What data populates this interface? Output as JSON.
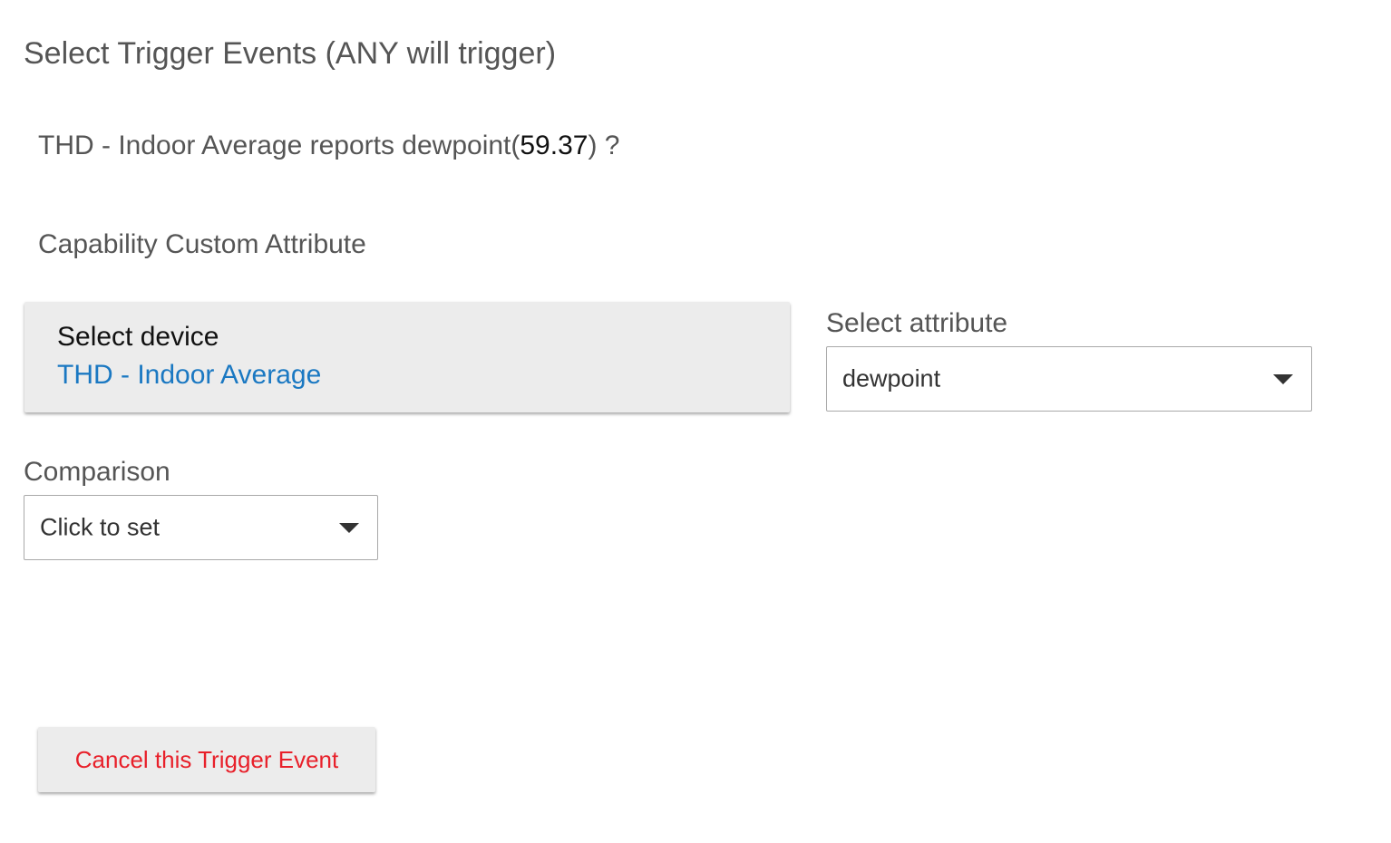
{
  "page": {
    "title": "Select Trigger Events (ANY will trigger)"
  },
  "trigger": {
    "summary_prefix": "THD - Indoor Average reports dewpoint(",
    "summary_value": "59.37",
    "summary_suffix": ") ?"
  },
  "capability": {
    "label": "Capability Custom Attribute"
  },
  "device": {
    "label": "Select device",
    "value": "THD - Indoor Average"
  },
  "attribute": {
    "label": "Select attribute",
    "value": "dewpoint"
  },
  "comparison": {
    "label": "Comparison",
    "value": "Click to set"
  },
  "actions": {
    "cancel_label": "Cancel this Trigger Event"
  },
  "colors": {
    "link_blue": "#1a78c2",
    "cancel_red": "#e8202a",
    "button_gray": "#ececec",
    "label_gray": "#555555"
  },
  "icons": {
    "dropdown": "caret-down-icon"
  }
}
